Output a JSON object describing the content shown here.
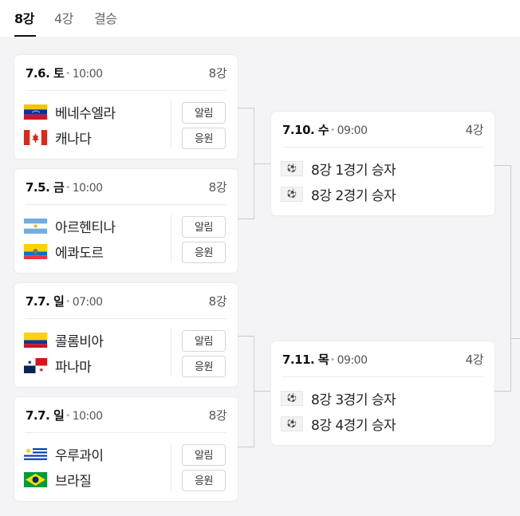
{
  "tabs": [
    {
      "label": "8강"
    },
    {
      "label": "4강"
    },
    {
      "label": "결승"
    }
  ],
  "quarterfinals": [
    {
      "date": "7.6. 토",
      "time": "10:00",
      "round": "8강",
      "teams": [
        {
          "name": "베네수엘라",
          "flag": "venezuela-flag"
        },
        {
          "name": "캐나다",
          "flag": "canada-flag"
        }
      ],
      "alarm": "알림",
      "cheer": "응원"
    },
    {
      "date": "7.5. 금",
      "time": "10:00",
      "round": "8강",
      "teams": [
        {
          "name": "아르헨티나",
          "flag": "argentina-flag"
        },
        {
          "name": "에콰도르",
          "flag": "ecuador-flag"
        }
      ],
      "alarm": "알림",
      "cheer": "응원"
    },
    {
      "date": "7.7. 일",
      "time": "07:00",
      "round": "8강",
      "teams": [
        {
          "name": "콜롬비아",
          "flag": "colombia-flag"
        },
        {
          "name": "파나마",
          "flag": "panama-flag"
        }
      ],
      "alarm": "알림",
      "cheer": "응원"
    },
    {
      "date": "7.7. 일",
      "time": "10:00",
      "round": "8강",
      "teams": [
        {
          "name": "우루과이",
          "flag": "uruguay-flag"
        },
        {
          "name": "브라질",
          "flag": "brazil-flag"
        }
      ],
      "alarm": "알림",
      "cheer": "응원"
    }
  ],
  "semifinals": [
    {
      "date": "7.10. 수",
      "time": "09:00",
      "round": "4강",
      "teams": [
        {
          "name": "8강 1경기 승자",
          "flag": "ball-icon"
        },
        {
          "name": "8강 2경기 승자",
          "flag": "ball-icon"
        }
      ]
    },
    {
      "date": "7.11. 목",
      "time": "09:00",
      "round": "4강",
      "teams": [
        {
          "name": "8강 3경기 승자",
          "flag": "ball-icon"
        },
        {
          "name": "8강 4경기 승자",
          "flag": "ball-icon"
        }
      ]
    }
  ],
  "colors": {
    "active_tab": "#111111",
    "inactive_tab": "#666666",
    "background": "#f4f4f6",
    "card": "#ffffff",
    "connector": "#cccccc"
  }
}
